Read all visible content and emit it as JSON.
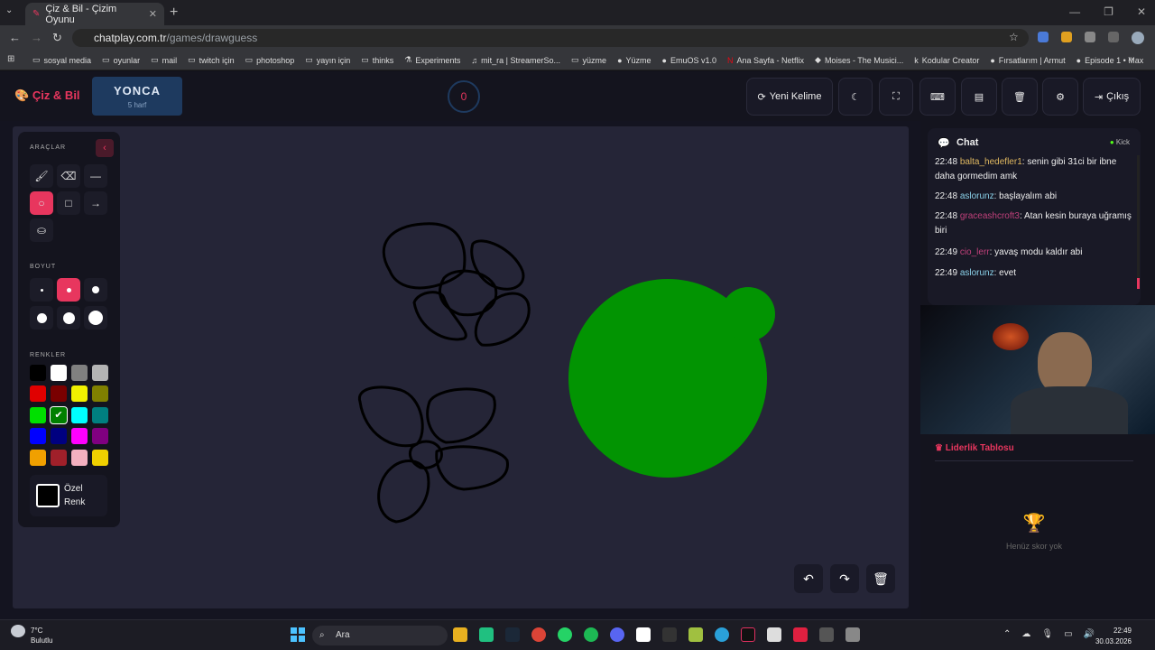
{
  "browser": {
    "tab_title": "Çiz & Bil - Çizim Oyunu",
    "url_domain": "chatplay.com.tr",
    "url_path": "/games/drawguess",
    "bookmarks": [
      "sosyal media",
      "oyunlar",
      "mail",
      "twitch için",
      "photoshop",
      "yayın için",
      "thinks",
      "Experiments",
      "mit_ra | StreamerSo...",
      "yüzme",
      "Yüzme",
      "EmuOS v1.0",
      "Ana Sayfa - Netflix",
      "Moises - The Musici...",
      "Kodular Creator",
      "Fırsatlarım | Armut",
      "Episode 1 • Max"
    ]
  },
  "header": {
    "logo": "Çiz & Bil",
    "word": "YONCA",
    "word_hint": "5 harf",
    "timer": "0",
    "new_word_label": "Yeni Kelime",
    "exit_label": "Çıkış"
  },
  "tools": {
    "tools_title": "ARAÇLAR",
    "size_title": "BOYUT",
    "colors_title": "RENKLER",
    "custom_color_label": "Özel Renk",
    "colors": [
      "#000000",
      "#ffffff",
      "#808080",
      "#b4b4b4",
      "#e00000",
      "#7a0000",
      "#f0f000",
      "#808000",
      "#00e000",
      "#008000",
      "#00ffff",
      "#008080",
      "#0000ff",
      "#000080",
      "#ff00ff",
      "#800080",
      "#f0a000",
      "#a0202a",
      "#f4b0c0",
      "#f0d000"
    ]
  },
  "chat": {
    "title": "Chat",
    "platform": "Kick",
    "messages": [
      {
        "time": "22:48",
        "user": "balta_hedefler1",
        "color": "#e0b860",
        "text": ": senin gibi 31ci bir ibne daha gormedim amk"
      },
      {
        "time": "22:48",
        "user": "aslorunz",
        "color": "#8ad0e8",
        "text": ": başlayalım abi"
      },
      {
        "time": "22:48",
        "user": "graceashcroft3",
        "color": "#c0407a",
        "text": ": Atan kesin buraya uğramış biri"
      },
      {
        "time": "22:49",
        "user": "cio_lerr",
        "color": "#c0407a",
        "text": ": yavaş modu kaldır abi"
      },
      {
        "time": "22:49",
        "user": "aslorunz",
        "color": "#8ad0e8",
        "text": ": evet"
      }
    ]
  },
  "leaderboard": {
    "title": "Liderlik Tablosu",
    "empty_text": "Henüz skor yok"
  },
  "taskbar": {
    "weather_temp": "7°C",
    "weather_desc": "Bulutlu",
    "search_label": "Ara",
    "time": "22:49",
    "date": "30.03.2026"
  },
  "accent": "#e8365e"
}
